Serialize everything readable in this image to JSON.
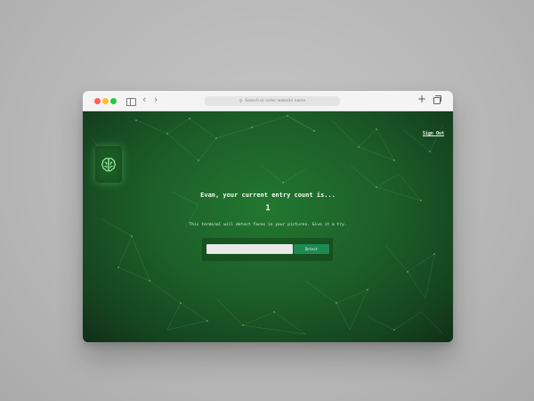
{
  "browser": {
    "address_placeholder": "Search or enter website name"
  },
  "header": {
    "sign_out_label": "Sign Out"
  },
  "logo": {
    "icon": "brain-icon",
    "color": "#9ff0a8"
  },
  "main": {
    "heading": "Evan, your current entry count is...",
    "entry_count": "1",
    "subtext": "This terminal will detect faces in your pictures. Give it a try.",
    "image_url_value": "",
    "detect_button_label": "Detect"
  },
  "colors": {
    "background_green": "#1d5f29",
    "button_green": "#1d8a52",
    "traffic_red": "#fe5f57",
    "traffic_yellow": "#febc2e",
    "traffic_green": "#28c840"
  }
}
